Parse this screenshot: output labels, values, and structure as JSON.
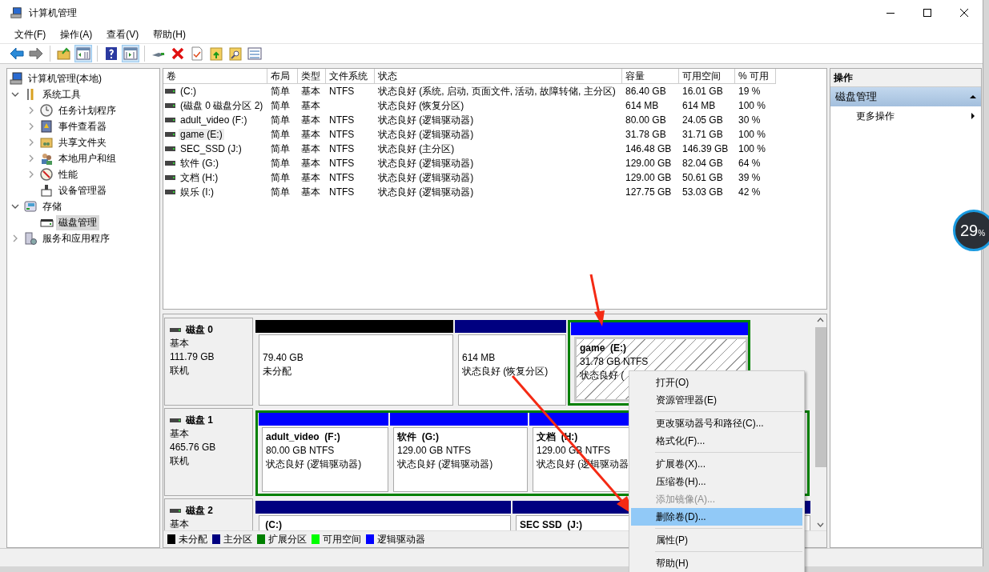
{
  "window": {
    "title": "计算机管理"
  },
  "menu": [
    "文件(F)",
    "操作(A)",
    "查看(V)",
    "帮助(H)"
  ],
  "toolbar": [
    {
      "kind": "back",
      "pressed": false
    },
    {
      "kind": "forward",
      "pressed": false
    },
    {
      "kind": "separator"
    },
    {
      "kind": "up-folder",
      "pressed": false
    },
    {
      "kind": "tree-pane",
      "pressed": true
    },
    {
      "kind": "separator"
    },
    {
      "kind": "help",
      "pressed": false
    },
    {
      "kind": "action-pane",
      "pressed": true
    },
    {
      "kind": "separator"
    },
    {
      "kind": "connect",
      "pressed": false
    },
    {
      "kind": "delete",
      "pressed": false
    },
    {
      "kind": "properties",
      "pressed": false
    },
    {
      "kind": "folder-up",
      "pressed": false
    },
    {
      "kind": "folder-search",
      "pressed": false
    },
    {
      "kind": "checklist",
      "pressed": false
    }
  ],
  "tree": [
    {
      "label": "计算机管理(本地)",
      "kind": "computer",
      "selected": false,
      "children": [
        {
          "label": "系统工具",
          "kind": "tools",
          "expanded": true,
          "selected": false,
          "children": [
            {
              "label": "任务计划程序",
              "kind": "clock",
              "expanded": false,
              "selected": false
            },
            {
              "label": "事件查看器",
              "kind": "log",
              "expanded": false,
              "selected": false
            },
            {
              "label": "共享文件夹",
              "kind": "share",
              "expanded": false,
              "selected": false
            },
            {
              "label": "本地用户和组",
              "kind": "users",
              "expanded": false,
              "selected": false
            },
            {
              "label": "性能",
              "kind": "gauge",
              "expanded": false,
              "selected": false
            },
            {
              "label": "设备管理器",
              "kind": "device",
              "selected": false
            }
          ]
        },
        {
          "label": "存储",
          "kind": "storage",
          "expanded": true,
          "selected": false,
          "children": [
            {
              "label": "磁盘管理",
              "kind": "disk",
              "selected": true
            }
          ]
        },
        {
          "label": "服务和应用程序",
          "kind": "services",
          "expanded": false,
          "selected": false
        }
      ]
    }
  ],
  "table": {
    "columns": [
      "卷",
      "布局",
      "类型",
      "文件系统",
      "状态",
      "容量",
      "可用空间",
      "% 可用"
    ],
    "rows": [
      {
        "selected": false,
        "cells": [
          " (C:)",
          "简单",
          "基本",
          "NTFS",
          "状态良好 (系统, 启动, 页面文件, 活动, 故障转储, 主分区)",
          "86.40 GB",
          "16.01 GB",
          "19 %"
        ]
      },
      {
        "selected": false,
        "cells": [
          "(磁盘 0 磁盘分区 2)",
          "简单",
          "基本",
          "",
          "状态良好 (恢复分区)",
          "614 MB",
          "614 MB",
          "100 %"
        ]
      },
      {
        "selected": false,
        "cells": [
          "adult_video (F:)",
          "简单",
          "基本",
          "NTFS",
          "状态良好 (逻辑驱动器)",
          "80.00 GB",
          "24.05 GB",
          "30 %"
        ]
      },
      {
        "selected": true,
        "cells": [
          "game (E:)",
          "简单",
          "基本",
          "NTFS",
          "状态良好 (逻辑驱动器)",
          "31.78 GB",
          "31.71 GB",
          "100 %"
        ]
      },
      {
        "selected": false,
        "cells": [
          "SEC_SSD (J:)",
          "简单",
          "基本",
          "NTFS",
          "状态良好 (主分区)",
          "146.48 GB",
          "146.39 GB",
          "100 %"
        ]
      },
      {
        "selected": false,
        "cells": [
          "软件 (G:)",
          "简单",
          "基本",
          "NTFS",
          "状态良好 (逻辑驱动器)",
          "129.00 GB",
          "82.04 GB",
          "64 %"
        ]
      },
      {
        "selected": false,
        "cells": [
          "文档 (H:)",
          "简单",
          "基本",
          "NTFS",
          "状态良好 (逻辑驱动器)",
          "129.00 GB",
          "50.61 GB",
          "39 %"
        ]
      },
      {
        "selected": false,
        "cells": [
          "娱乐 (I:)",
          "简单",
          "基本",
          "NTFS",
          "状态良好 (逻辑驱动器)",
          "127.75 GB",
          "53.03 GB",
          "42 %"
        ]
      }
    ]
  },
  "disks": [
    {
      "name": "磁盘 0",
      "type": "基本",
      "size": "111.79 GB",
      "status": "联机",
      "partitions": [
        {
          "kind": "unallocated",
          "selected": false,
          "lines": [
            "79.40 GB",
            "未分配"
          ]
        },
        {
          "kind": "primary",
          "selected": false,
          "lines": [
            "614 MB",
            "状态良好 (恢复分区)"
          ]
        },
        {
          "kind": "extended",
          "children": [
            {
              "kind": "logical",
              "selected": true,
              "title": "game  (E:)",
              "lines": [
                "31.78 GB NTFS",
                "状态良好 ("
              ]
            }
          ]
        }
      ]
    },
    {
      "name": "磁盘 1",
      "type": "基本",
      "size": "465.76 GB",
      "status": "联机",
      "partitions": [
        {
          "kind": "extended",
          "children": [
            {
              "kind": "logical",
              "selected": false,
              "title": "adult_video  (F:)",
              "lines": [
                "80.00 GB NTFS",
                "状态良好 (逻辑驱动器)"
              ]
            },
            {
              "kind": "logical",
              "selected": false,
              "title": "软件  (G:)",
              "lines": [
                "129.00 GB NTFS",
                "状态良好 (逻辑驱动器)"
              ]
            },
            {
              "kind": "logical",
              "selected": false,
              "title": "文档  (H:)",
              "lines": [
                "129.00 GB NTFS",
                "状态良好 (逻辑驱动器"
              ]
            }
          ]
        }
      ]
    },
    {
      "name": "磁盘 2",
      "type": "基本",
      "partitions": [
        {
          "kind": "primary",
          "selected": false,
          "title": " (C:)"
        },
        {
          "kind": "primary",
          "selected": false,
          "title": "SEC SSD  (J:)"
        }
      ]
    }
  ],
  "legend": [
    {
      "label": "未分配",
      "color": "#000000"
    },
    {
      "label": "主分区",
      "color": "#000080"
    },
    {
      "label": "扩展分区",
      "color": "#008000"
    },
    {
      "label": "可用空间",
      "color": "#00ff00"
    },
    {
      "label": "逻辑驱动器",
      "color": "#0000ff"
    }
  ],
  "actions": {
    "title": "操作",
    "sections": [
      {
        "label": "磁盘管理",
        "expanded": true,
        "items": [
          "更多操作"
        ]
      }
    ]
  },
  "context_menu": {
    "groups": [
      [
        {
          "label": "打开(O)",
          "disabled": false,
          "selected": false
        },
        {
          "label": "资源管理器(E)",
          "disabled": false,
          "selected": false
        }
      ],
      [
        {
          "label": "更改驱动器号和路径(C)...",
          "disabled": false,
          "selected": false
        },
        {
          "label": "格式化(F)...",
          "disabled": false,
          "selected": false
        }
      ],
      [
        {
          "label": "扩展卷(X)...",
          "disabled": false,
          "selected": false
        },
        {
          "label": "压缩卷(H)...",
          "disabled": false,
          "selected": false
        },
        {
          "label": "添加镜像(A)...",
          "disabled": true,
          "selected": false
        },
        {
          "label": "删除卷(D)...",
          "disabled": false,
          "selected": true
        }
      ],
      [
        {
          "label": "属性(P)",
          "disabled": false,
          "selected": false
        }
      ],
      [
        {
          "label": "帮助(H)",
          "disabled": false,
          "selected": false
        }
      ]
    ]
  },
  "widget": {
    "value": "29",
    "unit": "%"
  }
}
